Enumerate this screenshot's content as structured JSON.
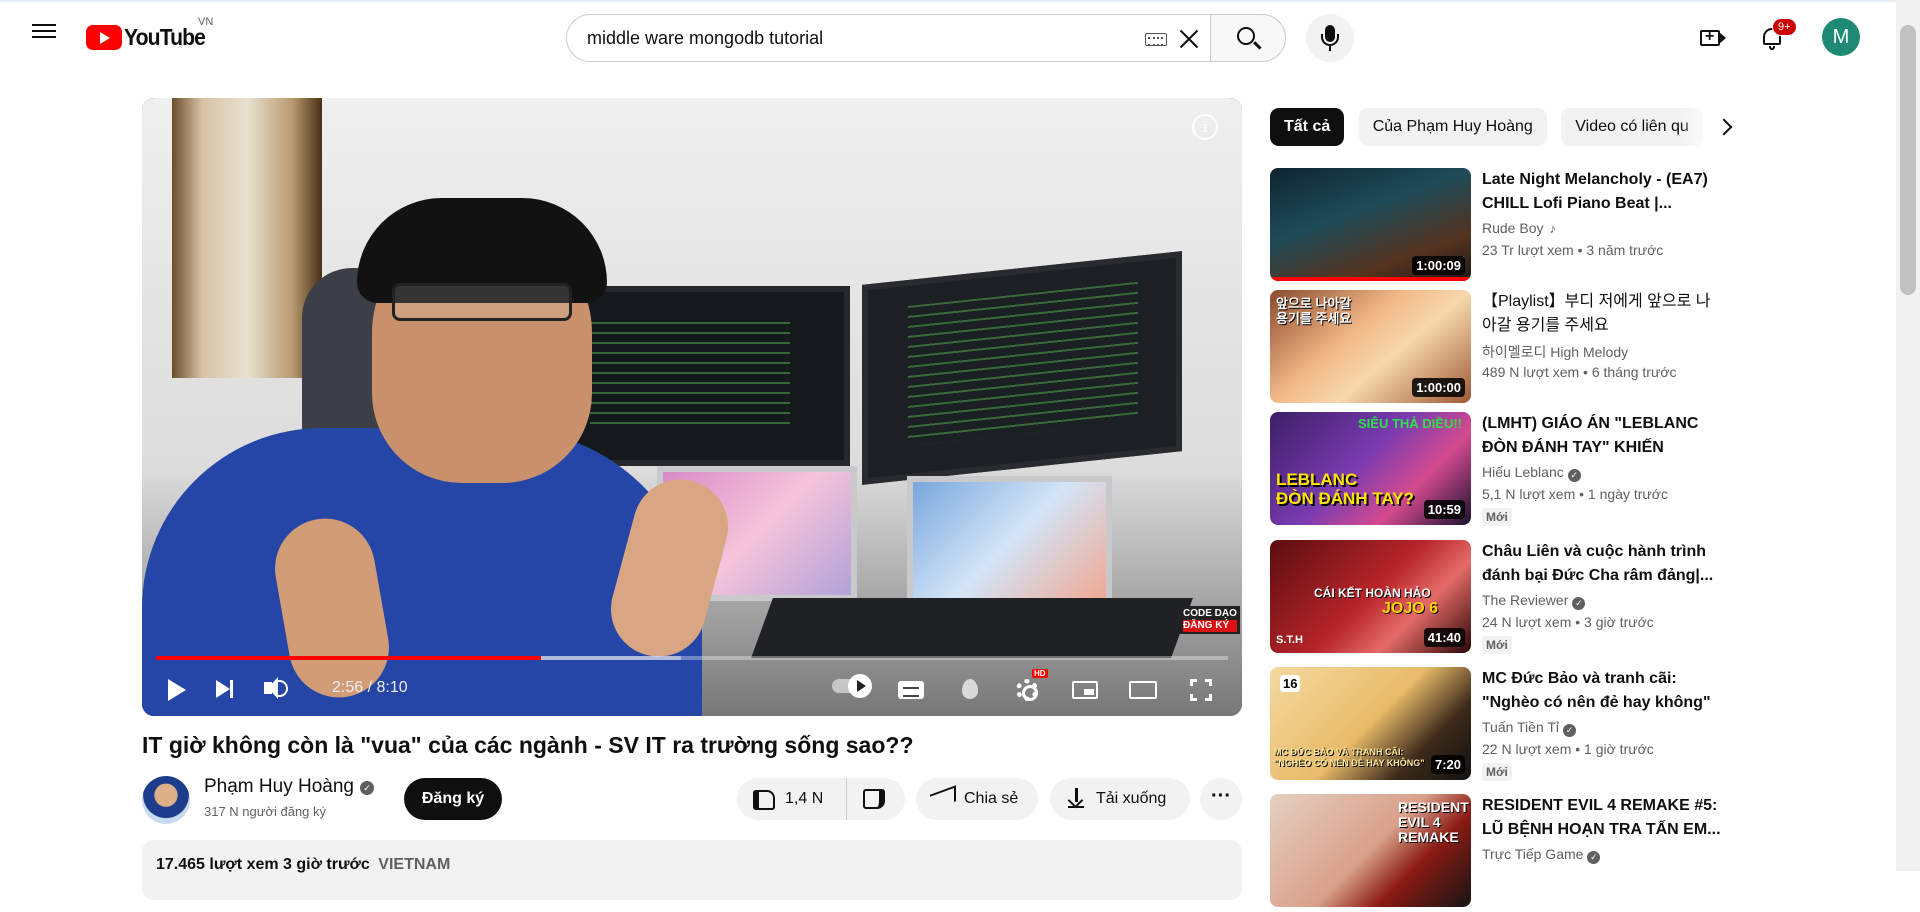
{
  "header": {
    "logo_text": "YouTube",
    "country_code": "VN",
    "search_value": "middle ware mongodb tutorial",
    "notification_count": "9+",
    "avatar_letter": "M"
  },
  "player": {
    "time_display": "2:56 / 8:10",
    "progress_played": 0.359,
    "progress_loaded": 0.49,
    "hd_badge": "HD",
    "watermark_top": "CODE DẠO",
    "watermark_bottom": "ĐĂNG KÝ",
    "info_icon": "i"
  },
  "video": {
    "title": "IT giờ không còn là \"vua\" của các ngành - SV IT ra trường sống sao??",
    "channel_name": "Phạm Huy Hoàng",
    "subscribers": "317 N người đăng ký",
    "subscribe_label": "Đăng ký",
    "like_count": "1,4 N",
    "share_label": "Chia sẻ",
    "download_label": "Tải xuống",
    "more_label": "···",
    "views_time": "17.465 lượt xem  3 giờ trước",
    "location": "VIETNAM"
  },
  "chips": [
    "Tất cả",
    "Của Phạm Huy Hoàng",
    "Video có liên qu"
  ],
  "recommendations": [
    {
      "title": "Late Night Melancholy - (EA7) CHILL Lofi Piano Beat |...",
      "channel": "Rude Boy",
      "meta": "23 Tr lượt xem  • 3 năm trước",
      "duration": "1:00:09",
      "badge": "",
      "verified": false,
      "music": true
    },
    {
      "title": "【Playlist】부디 저에게 앞으로 나아갈 용기를 주세요",
      "channel": "하이멜로디 High Melody",
      "meta": "489 N lượt xem  • 6 tháng trước",
      "duration": "1:00:00",
      "badge": "",
      "verified": false,
      "music": false
    },
    {
      "title": "(LMHT) GIÁO ÁN \"LEBLANC ĐÒN ĐÁNH TAY\" KHIẾN TEAM...",
      "channel": "Hiếu Leblanc",
      "meta": "5,1 N lượt xem  • 1 ngày trước",
      "duration": "10:59",
      "badge": "Mới",
      "verified": true,
      "music": false
    },
    {
      "title": "Châu Liên và cuộc hành trình đánh bại Đức Cha râm đảng|...",
      "channel": "The Reviewer",
      "meta": "24 N lượt xem  • 3 giờ trước",
      "duration": "41:40",
      "badge": "Mới",
      "verified": true,
      "music": false
    },
    {
      "title": "MC Đức Bảo và tranh cãi: \"Nghèo có nên đẻ hay không\" |...",
      "channel": "Tuấn Tiền Tỉ",
      "meta": "22 N lượt xem  • 1 giờ trước",
      "duration": "7:20",
      "badge": "Mới",
      "verified": true,
      "music": false
    },
    {
      "title": "RESIDENT EVIL 4 REMAKE #5: LŨ BỆNH HOẠN TRA TẤN EM...",
      "channel": "Trực Tiếp Game",
      "meta": "",
      "duration": "",
      "badge": "",
      "verified": true,
      "music": false
    }
  ],
  "thumb_texts": {
    "t2": "앞으로 나아갈\n용기를 주세요",
    "t3a": "SIÊU THẢ DIỀU!!",
    "t3b": "LEBLANC\nĐÒN ĐÁNH TAY?",
    "t4a": "CÁI KẾT HOÀN HẢO",
    "t4b": "JOJO 6",
    "t4c": "S.T.H",
    "t5a": "16",
    "t5b": "MC ĐỨC BẢO VÀ TRANH CÃI:\n\"NGHÈO CÓ NÊN ĐẺ HAY KHÔNG\"",
    "t6": "RESIDENT\nEVIL 4\nREMAKE"
  },
  "colors": {
    "accent": "#ff0000",
    "subscribe_bg": "#0f0f0f",
    "chip_bg": "#f2f2f2",
    "muted_text": "#606060"
  }
}
